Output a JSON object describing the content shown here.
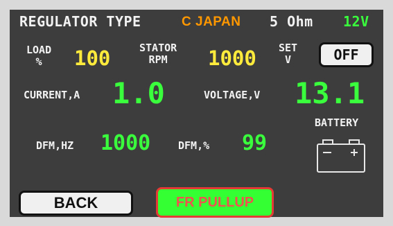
{
  "header": {
    "regulator_type_label": "REGULATOR TYPE",
    "regulator_type_value": "C JAPAN",
    "resistance": "5 Ohm",
    "voltage_rating": "12V"
  },
  "load": {
    "label_line1": "LOAD",
    "label_line2": "%",
    "value": "100"
  },
  "stator": {
    "label_line1": "STATOR",
    "label_line2": "RPM",
    "value": "1000"
  },
  "set_v": {
    "label_line1": "SET",
    "label_line2": "V",
    "button_label": "OFF"
  },
  "current": {
    "label": "CURRENT,A",
    "value": "1.0"
  },
  "voltage": {
    "label": "VOLTAGE,V",
    "value": "13.1"
  },
  "battery": {
    "label": "BATTERY",
    "icon": "battery-icon"
  },
  "dfm_hz": {
    "label": "DFM,HZ",
    "value": "1000"
  },
  "dfm_pct": {
    "label": "DFM,%",
    "value": "99"
  },
  "buttons": {
    "back": "BACK",
    "fr_pullup": "FR PULLUP"
  },
  "colors": {
    "background": "#3d3d3d",
    "label": "#f2f2f2",
    "yellow_value": "#ffeb3b",
    "green_value": "#39ff3c",
    "orange_value": "#ff9800",
    "fr_button_fill": "#33ff33",
    "fr_button_border": "#e53935"
  }
}
